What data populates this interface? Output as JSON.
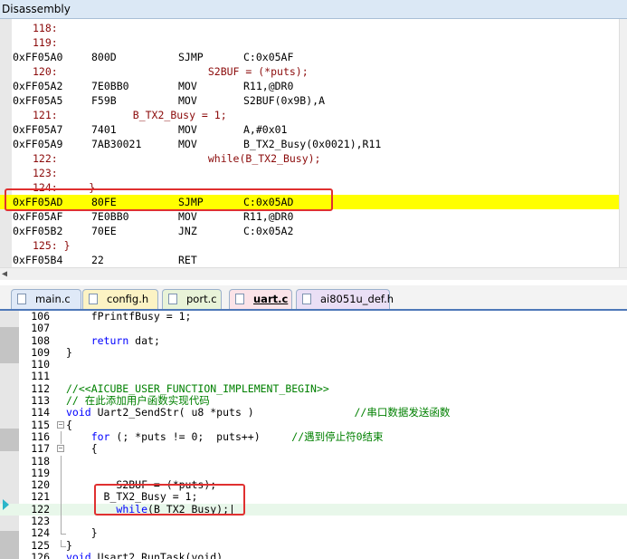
{
  "disassembly": {
    "title": "Disassembly",
    "lines": [
      {
        "addr": "",
        "bytes": "",
        "op": "",
        "arg": "",
        "src": "118:"
      },
      {
        "addr": "",
        "bytes": "",
        "op": "",
        "arg": "",
        "src": "119:"
      },
      {
        "addr": "0xFF05A0",
        "bytes": "800D",
        "op": "SJMP",
        "arg": "C:0x05AF",
        "src": ""
      },
      {
        "addr": "",
        "bytes": "",
        "op": "",
        "arg": "",
        "src": "120:                        S2BUF = (*puts);"
      },
      {
        "addr": "0xFF05A2",
        "bytes": "7E0BB0",
        "op": "MOV",
        "arg": "R11,@DR0",
        "src": ""
      },
      {
        "addr": "0xFF05A5",
        "bytes": "F59B",
        "op": "MOV",
        "arg": "S2BUF(0x9B),A",
        "src": ""
      },
      {
        "addr": "",
        "bytes": "",
        "op": "",
        "arg": "",
        "src": "121:            B_TX2_Busy = 1;"
      },
      {
        "addr": "0xFF05A7",
        "bytes": "7401",
        "op": "MOV",
        "arg": "A,#0x01",
        "src": ""
      },
      {
        "addr": "0xFF05A9",
        "bytes": "7AB30021",
        "op": "MOV",
        "arg": "B_TX2_Busy(0x0021),R11",
        "src": ""
      },
      {
        "addr": "",
        "bytes": "",
        "op": "",
        "arg": "",
        "src": "122:                        while(B_TX2_Busy);"
      },
      {
        "addr": "",
        "bytes": "",
        "op": "",
        "arg": "",
        "src": "123:"
      },
      {
        "addr": "",
        "bytes": "",
        "op": "",
        "arg": "",
        "src": "124:     }"
      },
      {
        "addr": "0xFF05AD",
        "bytes": "80FE",
        "op": "SJMP",
        "arg": "C:0x05AD",
        "src": "",
        "highlight": true
      },
      {
        "addr": "0xFF05AF",
        "bytes": "7E0BB0",
        "op": "MOV",
        "arg": "R11,@DR0",
        "src": ""
      },
      {
        "addr": "0xFF05B2",
        "bytes": "70EE",
        "op": "JNZ",
        "arg": "C:0x05A2",
        "src": ""
      },
      {
        "addr": "",
        "bytes": "",
        "op": "",
        "arg": "",
        "src": "125: }"
      },
      {
        "addr": "0xFF05B4",
        "bytes": "22",
        "op": "RET",
        "arg": "",
        "src": ""
      }
    ]
  },
  "tabs": [
    {
      "label": "main.c",
      "color": "#dfe9f7"
    },
    {
      "label": "config.h",
      "color": "#fcf3c4"
    },
    {
      "label": "port.c",
      "color": "#e8f3d8"
    },
    {
      "label": "uart.c",
      "color": "#fbe3e8",
      "active": true
    },
    {
      "label": "ai8051u_def.h",
      "color": "#eadff5"
    }
  ],
  "editor": {
    "lines": [
      {
        "n": "106",
        "code": "    fPrintfBusy = 1;"
      },
      {
        "n": "107",
        "code": ""
      },
      {
        "n": "108",
        "code": "    return dat;"
      },
      {
        "n": "109",
        "code": "}"
      },
      {
        "n": "110",
        "code": ""
      },
      {
        "n": "111",
        "code": ""
      },
      {
        "n": "112",
        "code": "//<<AICUBE_USER_FUNCTION_IMPLEMENT_BEGIN>>",
        "cls": "cm"
      },
      {
        "n": "113",
        "code": "// 在此添加用户函数实现代码",
        "cls": "cm"
      },
      {
        "n": "114",
        "code": "void Uart2_SendStr( u8 *puts )",
        "comment": "                //串口数据发送函数"
      },
      {
        "n": "115",
        "code": "{"
      },
      {
        "n": "116",
        "code": "    for (; *puts != 0;  puts++)",
        "comment": "     //遇到停止符0结束"
      },
      {
        "n": "117",
        "code": "    {"
      },
      {
        "n": "118",
        "code": ""
      },
      {
        "n": "119",
        "code": ""
      },
      {
        "n": "120",
        "code": "        S2BUF = (*puts);"
      },
      {
        "n": "121",
        "code": "      B_TX2_Busy = 1;"
      },
      {
        "n": "122",
        "code": "        while(B_TX2_Busy);|",
        "cur": true
      },
      {
        "n": "123",
        "code": ""
      },
      {
        "n": "124",
        "code": "    }"
      },
      {
        "n": "125",
        "code": "}"
      },
      {
        "n": "126",
        "code": "void Usart2_RunTask(void)"
      }
    ]
  }
}
